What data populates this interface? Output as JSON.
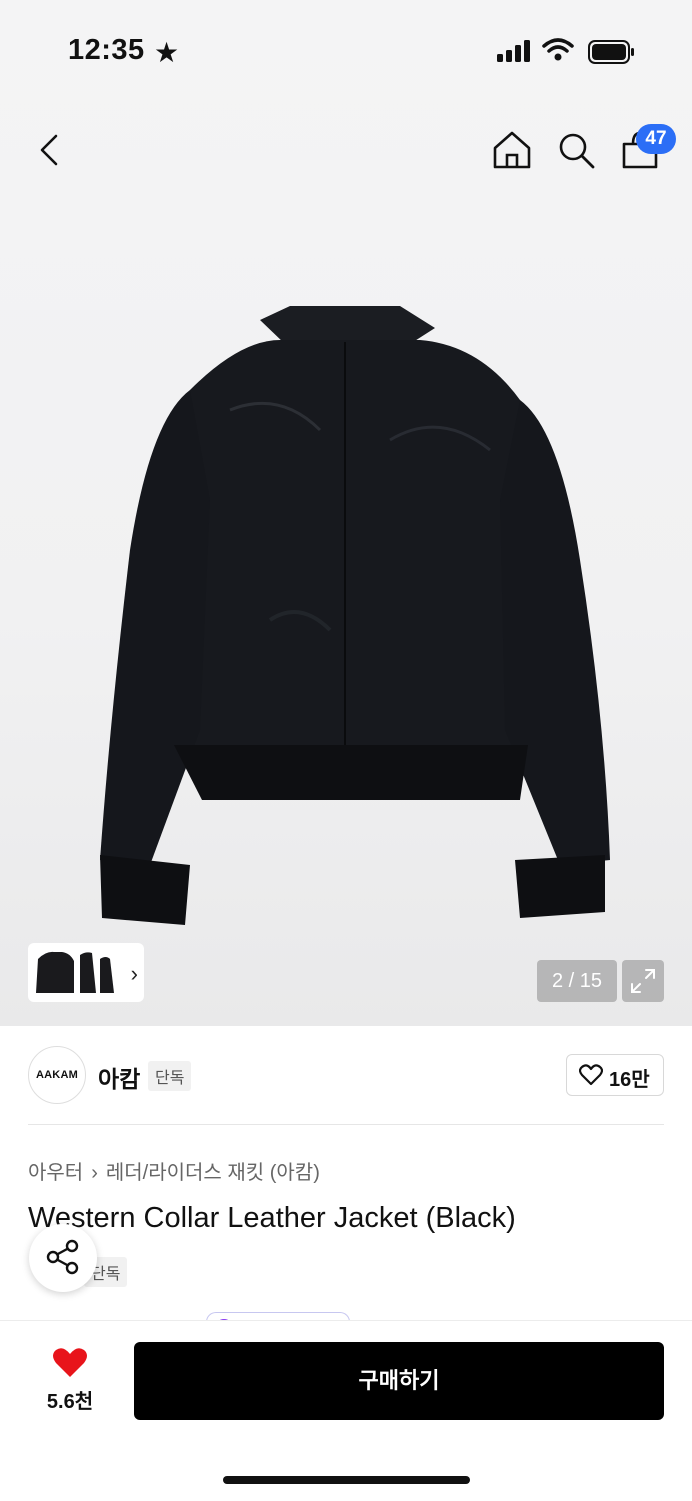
{
  "status_bar": {
    "time": "12:35",
    "star": "★"
  },
  "header": {
    "cart_count": "47"
  },
  "gallery": {
    "counter": "2 / 15",
    "thumb_chevron": "›"
  },
  "brand": {
    "logo_text": "AAKAM",
    "name": "아캄",
    "tag": "단독",
    "likes": "16만"
  },
  "breadcrumb": {
    "category": "아우터",
    "sep": "›",
    "subcategory": "레더/라이더스 재킷 (아캄)"
  },
  "product": {
    "title": "Western Collar Leather Jacket (Black)",
    "tag": "단독"
  },
  "bottom_bar": {
    "favorite_count": "5.6천",
    "buy_label": "구매하기"
  },
  "icons": [
    "back-arrow-icon",
    "home-icon",
    "search-icon",
    "shopping-bag-icon",
    "expand-icon",
    "heart-outline-icon",
    "share-icon",
    "heart-filled-icon"
  ],
  "colors": {
    "badge": "#2b6ef6",
    "buy_button": "#000000",
    "heart": "#e8141b"
  }
}
